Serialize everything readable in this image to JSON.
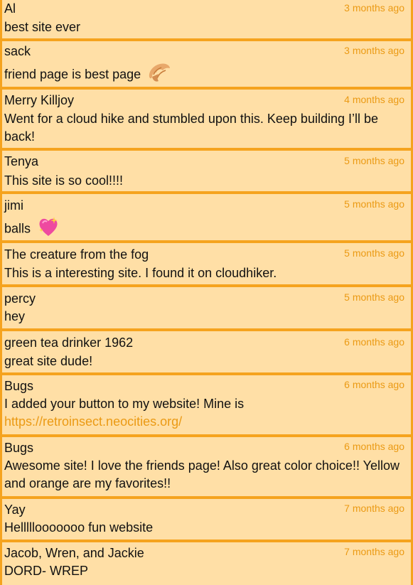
{
  "colors": {
    "background": "#ffdfa6",
    "border": "#f5a31e",
    "timestamp": "#eb9a14",
    "link": "#eb9a14"
  },
  "comments": [
    {
      "author": "Al",
      "time": "3 months ago",
      "body": "best site ever"
    },
    {
      "author": "sack",
      "time": "3 months ago",
      "body": "friend page is best page",
      "emoji": "croissant-icon"
    },
    {
      "author": "Merry Killjoy",
      "time": "4 months ago",
      "body": "Went for a cloud hike and stumbled upon this. Keep building I’ll be back!"
    },
    {
      "author": "Tenya",
      "time": "5 months ago",
      "body": "This site is so cool!!!!"
    },
    {
      "author": "jimi",
      "time": "5 months ago",
      "body": "balls",
      "emoji": "sparkling-heart-icon"
    },
    {
      "author": "The creature from the fog",
      "time": "5 months ago",
      "body": "This is a interesting site. I found it on cloudhiker."
    },
    {
      "author": "percy",
      "time": "5 months ago",
      "body": "hey"
    },
    {
      "author": "green tea drinker 1962",
      "time": "6 months ago",
      "body": "great site dude!"
    },
    {
      "author": "Bugs",
      "time": "6 months ago",
      "body": "I added your button to my website! Mine is",
      "link": "https://retroinsect.neocities.org/"
    },
    {
      "author": "Bugs",
      "time": "6 months ago",
      "body": "Awesome site! I love the friends page! Also great color choice!! Yellow and orange are my favorites!!"
    },
    {
      "author": "Yay",
      "time": "7 months ago",
      "body": "Helllllooooooo fun website"
    },
    {
      "author": "Jacob, Wren, and Jackie",
      "time": "7 months ago",
      "body": "DORD- WREP"
    }
  ]
}
